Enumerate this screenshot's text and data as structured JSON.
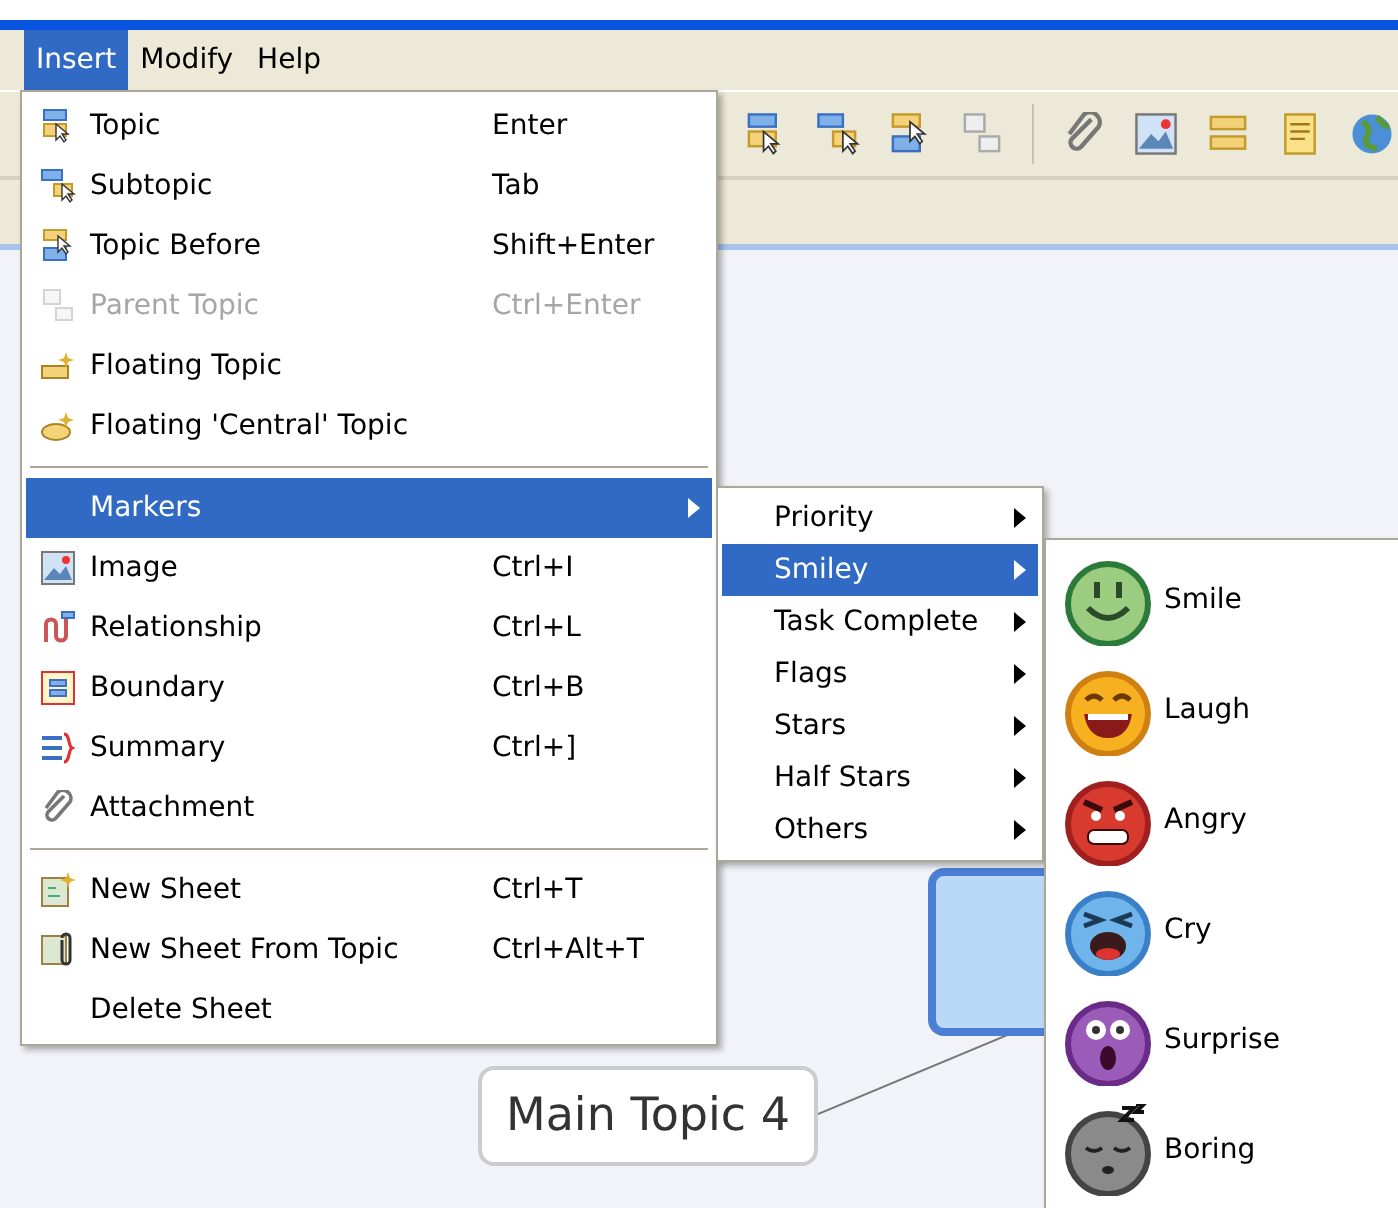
{
  "menubar": [
    {
      "label": "Insert",
      "selected": true
    },
    {
      "label": "Modify",
      "selected": false
    },
    {
      "label": "Help",
      "selected": false
    }
  ],
  "insert_menu": {
    "groups": [
      {
        "items": [
          {
            "label": "Topic",
            "shortcut": "Enter",
            "disabled": false,
            "selected": false,
            "submenu": false
          },
          {
            "label": "Subtopic",
            "shortcut": "Tab",
            "disabled": false,
            "selected": false,
            "submenu": false
          },
          {
            "label": "Topic Before",
            "shortcut": "Shift+Enter",
            "disabled": false,
            "selected": false,
            "submenu": false
          },
          {
            "label": "Parent Topic",
            "shortcut": "Ctrl+Enter",
            "disabled": true,
            "selected": false,
            "submenu": false
          },
          {
            "label": "Floating Topic",
            "disabled": false,
            "selected": false,
            "submenu": false
          },
          {
            "label": "Floating 'Central' Topic",
            "disabled": false,
            "selected": false,
            "submenu": false
          }
        ]
      },
      {
        "items": [
          {
            "label": "Markers",
            "disabled": false,
            "selected": true,
            "submenu": true
          },
          {
            "label": "Image",
            "shortcut": "Ctrl+I",
            "disabled": false,
            "selected": false,
            "submenu": false
          },
          {
            "label": "Relationship",
            "shortcut": "Ctrl+L",
            "disabled": false,
            "selected": false,
            "submenu": false
          },
          {
            "label": "Boundary",
            "shortcut": "Ctrl+B",
            "disabled": false,
            "selected": false,
            "submenu": false
          },
          {
            "label": "Summary",
            "shortcut": "Ctrl+]",
            "disabled": false,
            "selected": false,
            "submenu": false
          },
          {
            "label": "Attachment",
            "disabled": false,
            "selected": false,
            "submenu": false
          }
        ]
      },
      {
        "items": [
          {
            "label": "New Sheet",
            "shortcut": "Ctrl+T",
            "disabled": false,
            "selected": false,
            "submenu": false
          },
          {
            "label": "New Sheet From Topic",
            "shortcut": "Ctrl+Alt+T",
            "disabled": false,
            "selected": false,
            "submenu": false
          },
          {
            "label": "Delete Sheet",
            "disabled": false,
            "selected": false,
            "submenu": false
          }
        ]
      }
    ]
  },
  "markers_menu": {
    "items": [
      {
        "label": "Priority",
        "selected": false
      },
      {
        "label": "Smiley",
        "selected": true
      },
      {
        "label": "Task Complete",
        "selected": false
      },
      {
        "label": "Flags",
        "selected": false
      },
      {
        "label": "Stars",
        "selected": false
      },
      {
        "label": "Half Stars",
        "selected": false
      },
      {
        "label": "Others",
        "selected": false
      }
    ]
  },
  "smiley_menu": {
    "items": [
      {
        "label": "Smile"
      },
      {
        "label": "Laugh"
      },
      {
        "label": "Angry"
      },
      {
        "label": "Cry"
      },
      {
        "label": "Surprise"
      },
      {
        "label": "Boring"
      }
    ]
  },
  "canvas": {
    "topic": {
      "label": "Main Topic 4"
    }
  }
}
